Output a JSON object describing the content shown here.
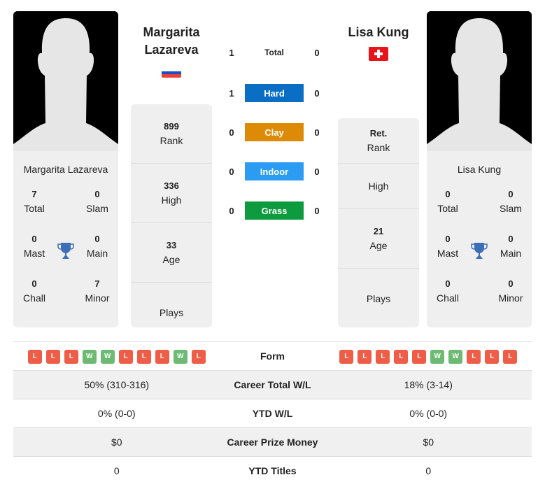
{
  "player1": {
    "name": "Margarita Lazareva",
    "title_line1": "Margarita",
    "title_line2": "Lazareva",
    "flag": "russia-flag",
    "rank": "899",
    "rank_label": "Rank",
    "high": "336",
    "high_label": "High",
    "age": "33",
    "age_label": "Age",
    "plays_label": "Plays",
    "titles": {
      "total": "7",
      "total_label": "Total",
      "slam": "0",
      "slam_label": "Slam",
      "mast": "0",
      "mast_label": "Mast",
      "main": "0",
      "main_label": "Main",
      "chall": "0",
      "chall_label": "Chall",
      "minor": "7",
      "minor_label": "Minor"
    }
  },
  "player2": {
    "name": "Lisa Kung",
    "title_line1": "Lisa Kung",
    "flag": "switzerland-flag",
    "rank": "Ret.",
    "rank_label": "Rank",
    "high": "",
    "high_label": "High",
    "age": "21",
    "age_label": "Age",
    "plays_label": "Plays",
    "titles": {
      "total": "0",
      "total_label": "Total",
      "slam": "0",
      "slam_label": "Slam",
      "mast": "0",
      "mast_label": "Mast",
      "main": "0",
      "main_label": "Main",
      "chall": "0",
      "chall_label": "Chall",
      "minor": "0",
      "minor_label": "Minor"
    }
  },
  "h2h": [
    {
      "label": "Total",
      "p1": "1",
      "p2": "0",
      "color": ""
    },
    {
      "label": "Hard",
      "p1": "1",
      "p2": "0",
      "color": "#0a6ec4"
    },
    {
      "label": "Clay",
      "p1": "0",
      "p2": "0",
      "color": "#dd8a06"
    },
    {
      "label": "Indoor",
      "p1": "0",
      "p2": "0",
      "color": "#2b9cf2"
    },
    {
      "label": "Grass",
      "p1": "0",
      "p2": "0",
      "color": "#0e9a3e"
    }
  ],
  "colors": {
    "win": "#6dbb73",
    "loss": "#ef5d47",
    "trophy": "#3d6fb8"
  },
  "comparison": {
    "form_label": "Form",
    "p1_form": [
      "L",
      "L",
      "L",
      "W",
      "W",
      "L",
      "L",
      "L",
      "W",
      "L"
    ],
    "p2_form": [
      "L",
      "L",
      "L",
      "L",
      "L",
      "W",
      "W",
      "L",
      "L",
      "L"
    ],
    "rows": [
      {
        "label": "Career Total W/L",
        "p1": "50% (310-316)",
        "p2": "18% (3-14)"
      },
      {
        "label": "YTD W/L",
        "p1": "0% (0-0)",
        "p2": "0% (0-0)"
      },
      {
        "label": "Career Prize Money",
        "p1": "$0",
        "p2": "$0"
      },
      {
        "label": "YTD Titles",
        "p1": "0",
        "p2": "0"
      }
    ]
  }
}
